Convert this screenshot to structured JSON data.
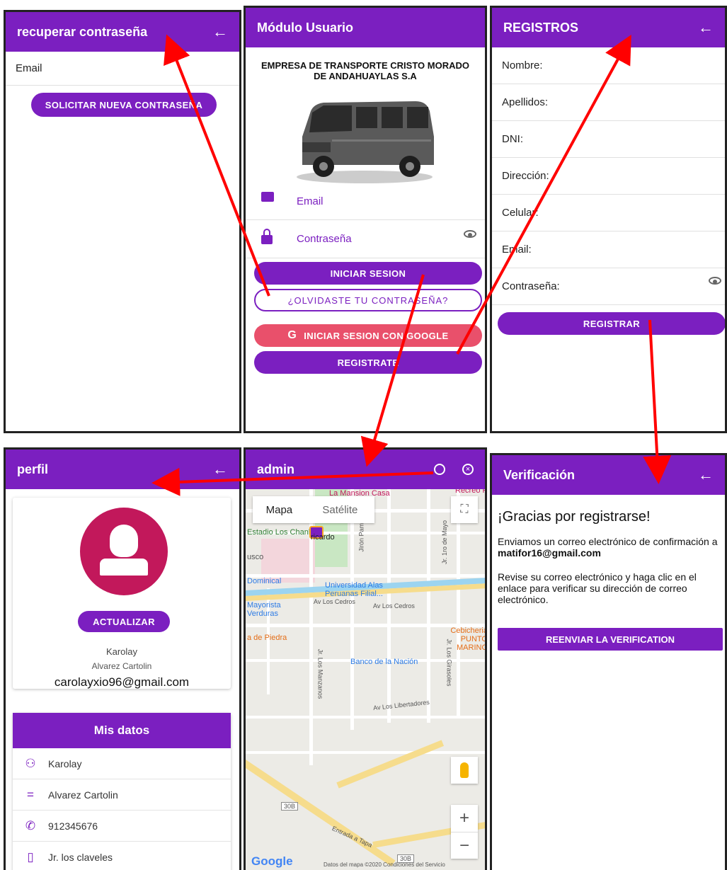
{
  "panels": {
    "recover": {
      "title": "recuperar contraseña",
      "email_label": "Email",
      "button": "SOLICITAR NUEVA CONTRASEÑA"
    },
    "login": {
      "title": "Módulo Usuario",
      "company": "EMPRESA DE TRANSPORTE CRISTO MORADO DE ANDAHUAYLAS S.A",
      "email_label": "Email",
      "password_label": "Contraseña",
      "login_button": "INICIAR SESION",
      "forgot_button": "¿OLVIDASTE TU CONTRASEÑA?",
      "google_button": "INICIAR SESION CON GOOGLE",
      "register_button": "REGISTRATE"
    },
    "register": {
      "title": "REGISTROS",
      "fields": [
        "Nombre:",
        "Apellidos:",
        "DNI:",
        "Dirección:",
        "Celular:",
        "Email:",
        "Contraseña:"
      ],
      "button": "REGISTRAR"
    },
    "profile": {
      "title": "perfil",
      "update_button": "ACTUALIZAR",
      "name": "Karolay",
      "surname": "Alvarez Cartolin",
      "email": "carolayxio96@gmail.com",
      "section_title": "Mis datos",
      "data_rows": [
        "Karolay",
        "Alvarez Cartolin",
        "912345676",
        "Jr. los claveles"
      ]
    },
    "map": {
      "title": "admin",
      "tab_map": "Mapa",
      "tab_satellite": "Satélite",
      "marker_label": "ricardo",
      "labels": {
        "mansion": "La Mansion Casa",
        "recreo": "Recreo F",
        "estadio": "Estadio Los Chankas",
        "usco": "usco",
        "dominical": "Dominical",
        "universidad": "Universidad Alas Peruanas Filial...",
        "mayorista": "Mayorista Verduras",
        "cedros1": "Av Los Cedros",
        "cedros2": "Av Los Cedros",
        "piedra": "a de Piedra",
        "cebicheria": "Cebicheria PUNTO MARINO",
        "banco": "Banco de la Nación",
        "libertadores": "Av Los Libertadores",
        "pampachiri": "Jirón Pampachiri",
        "mayo": "Jr. 1ro de Mayo",
        "manzanos": "Jr. Los Manzanos",
        "girasoles": "Jr. Los Girasoles",
        "route": "30B",
        "route2": "30B",
        "tapa": "Entrada a Tapa",
        "google": "Google",
        "footer": "Datos del mapa ©2020   Condiciones del Servicio"
      }
    },
    "verify": {
      "title": "Verificación",
      "heading": "¡Gracias por registrarse!",
      "line1": "Enviamos un correo electrónico de confirmación a ",
      "email": "matifor16@gmail.com",
      "line2": "Revise su correo electrónico y haga clic en el enlace para verificar su dirección de correo electrónico.",
      "button": "REENVIAR LA VERIFICATION"
    }
  },
  "colors": {
    "primary": "#7b1fc0",
    "google": "#e9506b",
    "arrow": "#ff0000",
    "avatar": "#c2185b"
  }
}
